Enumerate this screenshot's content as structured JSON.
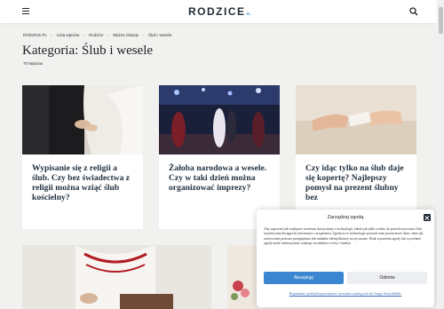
{
  "header": {
    "logo_text": "RODZICE",
    "logo_suffix": "PL"
  },
  "breadcrumb": [
    "RODZICE.PL",
    "Lista wpisów",
    "Rodzice",
    "Ważne Okazje",
    "Ślub i wesele"
  ],
  "category": {
    "title": "Kategoria: Ślub i wesele",
    "count": "70 Wpisów"
  },
  "cards": [
    {
      "title": "Wypisanie się z religii a ślub. Czy bez świadectwa z religii można wziąć ślub kościelny?"
    },
    {
      "title": "Żałoba narodowa a wesele. Czy w taki dzień można organizować imprezy?"
    },
    {
      "title": "Czy idąc tylko na ślub daje się kopertę? Najlepszy pomysł na prezent ślubny bez"
    }
  ],
  "cookie": {
    "title": "Zarządzaj zgodą",
    "text": "Aby zapewnić jak najlepsze wrażenia, korzystamy z technologii, takich jak pliki cookie, do przechowywania i/lub uzyskiwania dostępu do informacji o urządzeniu. Zgoda na te technologie pozwoli nam przetwarzać dane, takie jak zachowanie podczas przeglądania lub unikalne identyfikatory na tej stronie. Brak wyrażenia zgody lub wycofanie zgody może niekorzystnie wpłynąć na niektóre cechy i funkcje.",
    "accept": "Akceptuję",
    "reject": "Odmów",
    "links": "Regulamin i polityka prywatności serwisów należących do Grupy Search&Hit."
  }
}
